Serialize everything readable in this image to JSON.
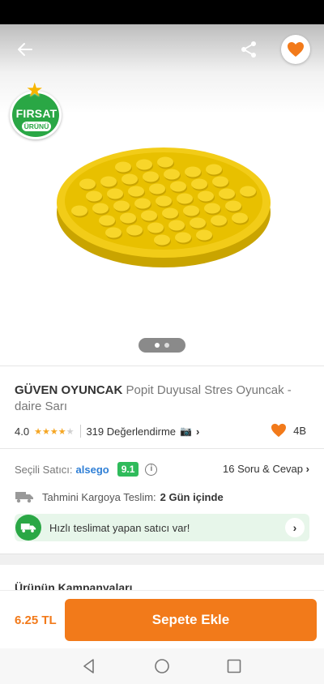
{
  "colors": {
    "accent": "#f27a1a",
    "seller_link": "#2f7fd6",
    "score_green": "#2fbb5b",
    "badge_green": "#2aa745"
  },
  "header": {
    "back_icon": "arrow-left-icon",
    "share_icon": "share-icon",
    "favorite_icon": "heart-icon"
  },
  "badge": {
    "line1": "FIRSAT",
    "line2": "ÜRÜNÜ"
  },
  "gallery": {
    "page_count": 2,
    "current_page": 1
  },
  "product": {
    "brand": "GÜVEN OYUNCAK",
    "name": "Popit Duyusal Stres Oyuncak -daire Sarı"
  },
  "rating": {
    "score": "4.0",
    "stars_filled": 4,
    "stars_total": 5,
    "reviews": "319 Değerlendirme",
    "favorites": "4B"
  },
  "seller": {
    "label": "Seçili Satıcı:",
    "name": "alsego",
    "score": "9.1",
    "qa": "16 Soru & Cevap"
  },
  "cargo": {
    "label": "Tahmini Kargoya Teslim:",
    "value": "2 Gün içinde"
  },
  "fast_delivery": {
    "text": "Hızlı teslimat yapan satıcı var!"
  },
  "campaign": {
    "title": "Ürünün Kampanyaları"
  },
  "bottom": {
    "price": "6.25 TL",
    "add_to_cart": "Sepete Ekle"
  },
  "nav": {
    "back": "triangle-back-icon",
    "home": "circle-home-icon",
    "recents": "square-recents-icon"
  }
}
